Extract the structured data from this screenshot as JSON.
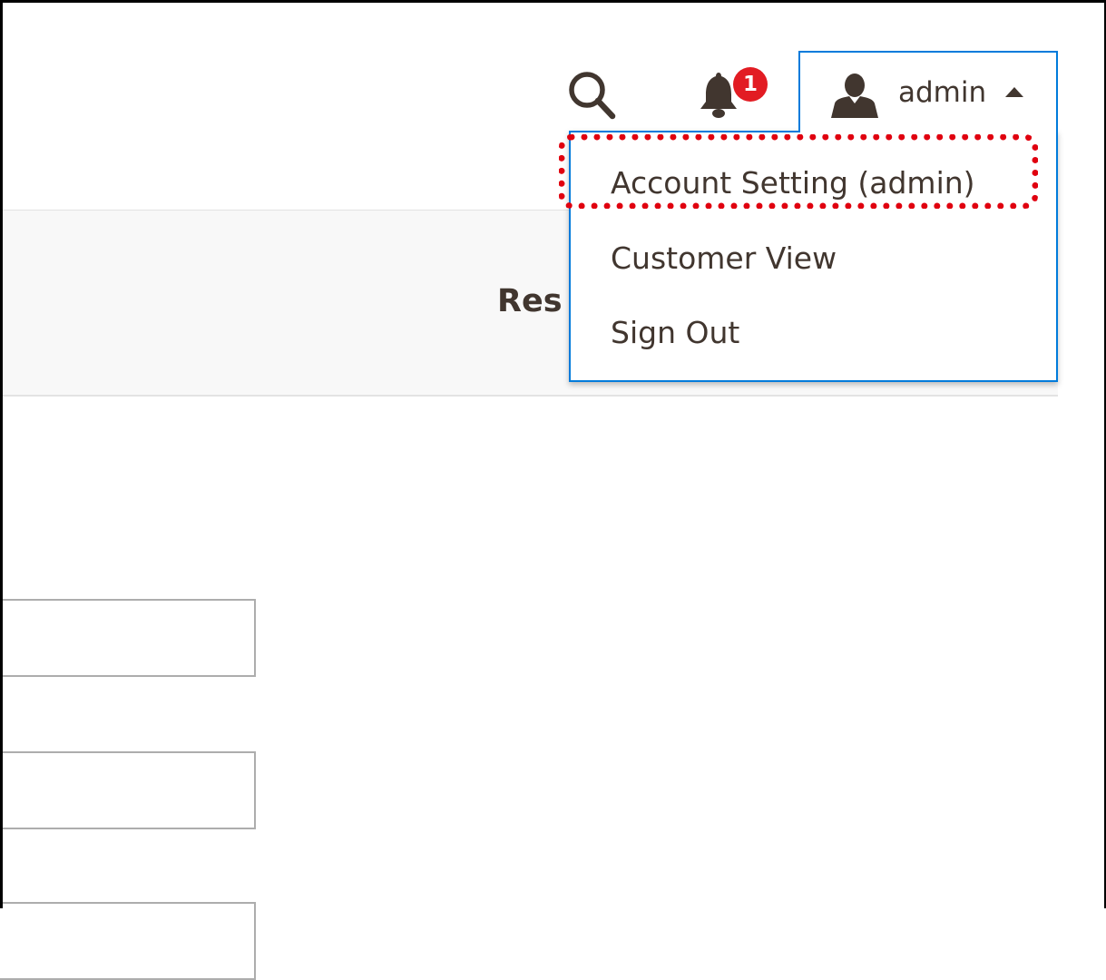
{
  "header": {
    "search_icon": "search-icon",
    "notifications": {
      "icon": "bell-icon",
      "count": "1",
      "badge_color": "#e21c23"
    },
    "user": {
      "icon": "user-icon",
      "name": "admin",
      "caret_icon": "caret-up-icon",
      "accent_color": "#007bdb"
    }
  },
  "user_menu": {
    "items": [
      {
        "label": "Account Setting (admin)",
        "highlighted": true
      },
      {
        "label": "Customer View"
      },
      {
        "label": "Sign Out"
      }
    ],
    "highlight_color": "#e0000f"
  },
  "page": {
    "band_text": "Res",
    "text_color": "#41362f"
  }
}
